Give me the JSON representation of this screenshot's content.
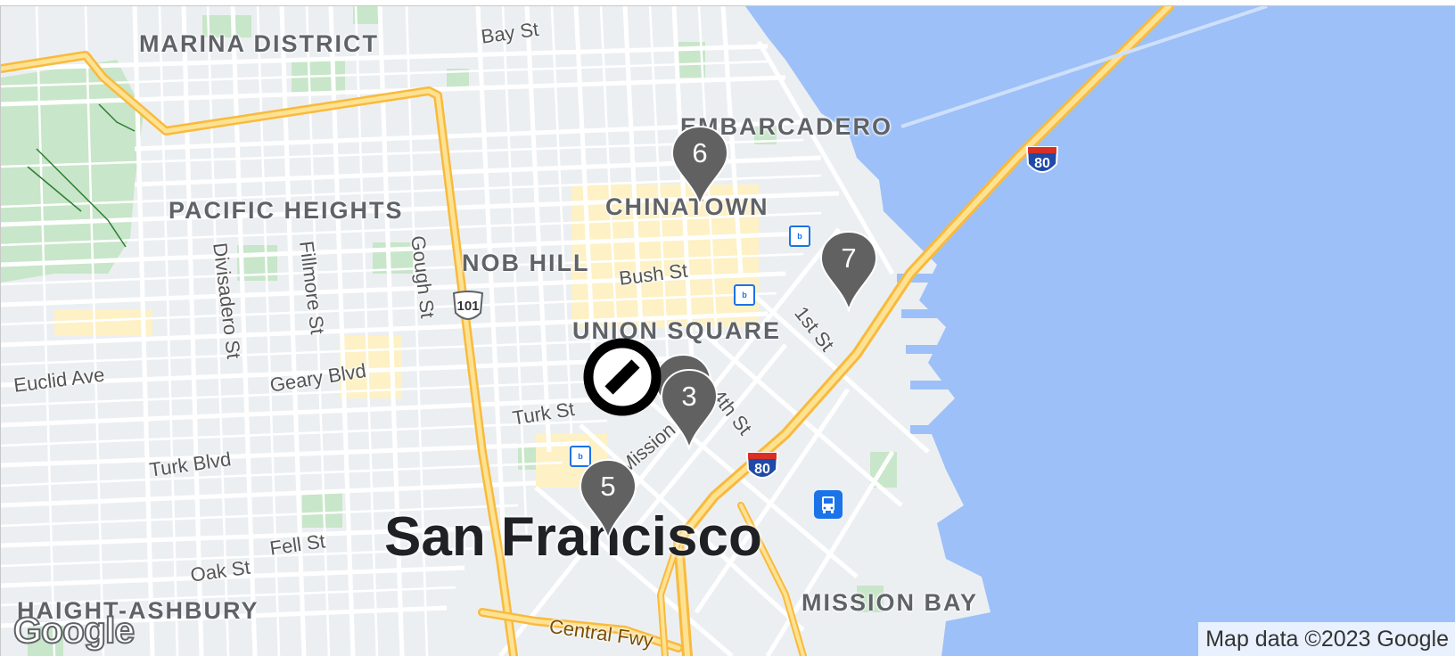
{
  "map": {
    "districts": {
      "marina": "MARINA DISTRICT",
      "embarcadero": "EMBARCADERO",
      "chinatown": "CHINATOWN",
      "pacific_heights": "PACIFIC HEIGHTS",
      "nob_hill": "NOB HILL",
      "union_square": "UNION SQUARE",
      "mission_bay": "MISSION BAY",
      "haight_ashbury": "HAIGHT-ASHBURY"
    },
    "city": "San Francisco",
    "streets": {
      "bay_st": "Bay St",
      "bush_st": "Bush St",
      "gough_st": "Gough St",
      "fillmore_st": "Fillmore St",
      "divisadero_st": "Divisadero St",
      "euclid_ave": "Euclid Ave",
      "geary_blvd": "Geary Blvd",
      "turk_st": "Turk St",
      "turk_blvd": "Turk Blvd",
      "fell_st": "Fell St",
      "oak_st": "Oak St",
      "first_st": "1st St",
      "fourth_st": "4th St",
      "mission_st": "Mission St",
      "central_fwy": "Central Fwy"
    },
    "highways": {
      "us101": "101",
      "i80_a": "80",
      "i80_b": "80"
    },
    "markers": [
      {
        "label": "6",
        "color": "#616161"
      },
      {
        "label": "7",
        "color": "#616161"
      },
      {
        "label": "3",
        "color": "#616161"
      },
      {
        "label": "5",
        "color": "#616161"
      }
    ],
    "blocked_marker": {
      "icon": "no-entry-icon"
    },
    "attribution": "Map data ©2023 Google",
    "logo": "Google",
    "colors": {
      "water": "#9dc0f8",
      "land": "#eceff2",
      "park": "#c8e6c9",
      "highway": "#f9ba3c",
      "highway_fill": "#fde293",
      "road": "#ffffff",
      "marker": "#616161"
    }
  }
}
